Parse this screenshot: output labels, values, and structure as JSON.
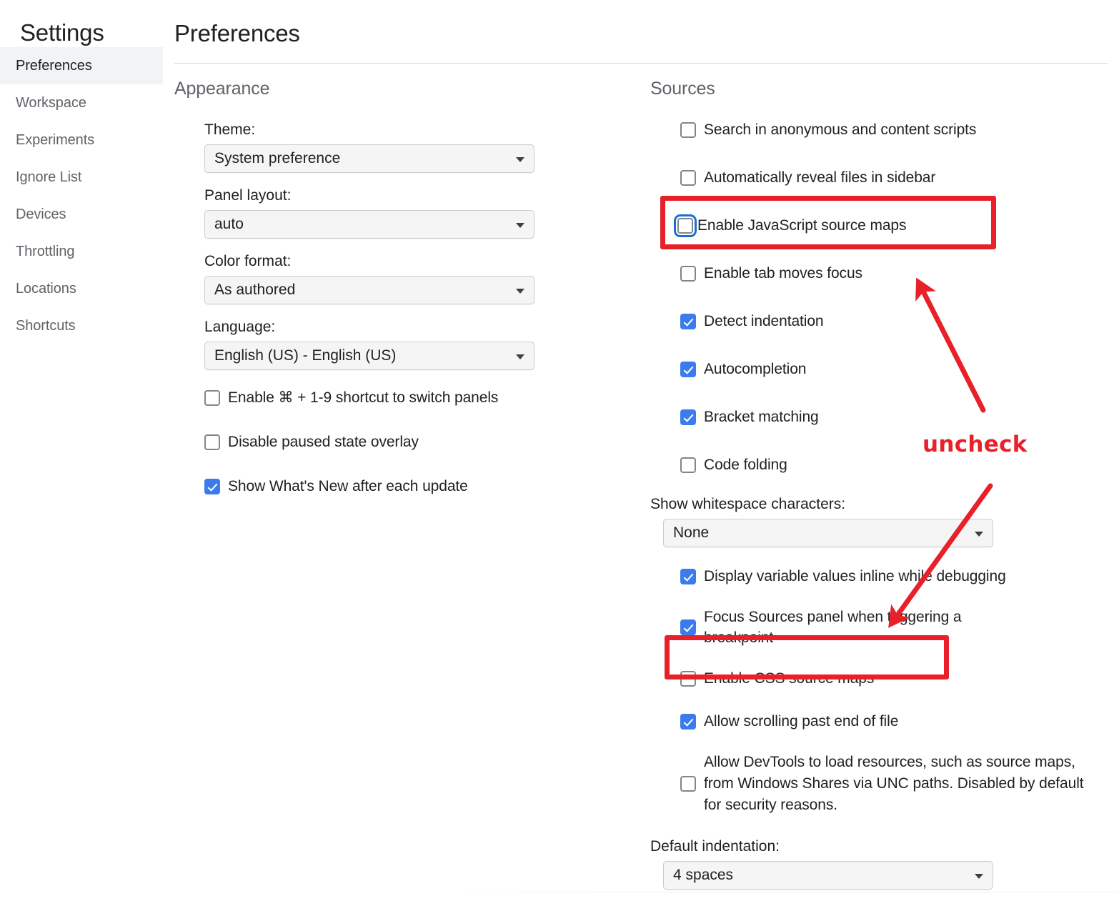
{
  "sidebar": {
    "title": "Settings",
    "items": [
      {
        "label": "Preferences",
        "selected": true
      },
      {
        "label": "Workspace",
        "selected": false
      },
      {
        "label": "Experiments",
        "selected": false
      },
      {
        "label": "Ignore List",
        "selected": false
      },
      {
        "label": "Devices",
        "selected": false
      },
      {
        "label": "Throttling",
        "selected": false
      },
      {
        "label": "Locations",
        "selected": false
      },
      {
        "label": "Shortcuts",
        "selected": false
      }
    ]
  },
  "page": {
    "title": "Preferences"
  },
  "appearance": {
    "heading": "Appearance",
    "theme": {
      "label": "Theme:",
      "value": "System preference"
    },
    "panel_layout": {
      "label": "Panel layout:",
      "value": "auto"
    },
    "color_format": {
      "label": "Color format:",
      "value": "As authored"
    },
    "language": {
      "label": "Language:",
      "value": "English (US) - English (US)"
    },
    "checkboxes": [
      {
        "label": "Enable ⌘ + 1-9 shortcut to switch panels",
        "checked": false
      },
      {
        "label": "Disable paused state overlay",
        "checked": false
      },
      {
        "label": "Show What's New after each update",
        "checked": true
      }
    ]
  },
  "sources": {
    "heading": "Sources",
    "checkboxes_top": [
      {
        "label": "Search in anonymous and content scripts",
        "checked": false
      },
      {
        "label": "Automatically reveal files in sidebar",
        "checked": false
      },
      {
        "label": "Enable JavaScript source maps",
        "checked": false,
        "focused": true,
        "annotated": true
      },
      {
        "label": "Enable tab moves focus",
        "checked": false
      },
      {
        "label": "Detect indentation",
        "checked": true
      },
      {
        "label": "Autocompletion",
        "checked": true
      },
      {
        "label": "Bracket matching",
        "checked": true
      },
      {
        "label": "Code folding",
        "checked": false
      }
    ],
    "whitespace": {
      "label": "Show whitespace characters:",
      "value": "None"
    },
    "checkboxes_mid": [
      {
        "label": "Display variable values inline while debugging",
        "checked": true
      },
      {
        "label": "Focus Sources panel when triggering a breakpoint",
        "checked": true
      },
      {
        "label": "Enable CSS source maps",
        "checked": false,
        "annotated": true
      },
      {
        "label": "Allow scrolling past end of file",
        "checked": true
      }
    ],
    "unc": {
      "label": "Allow DevTools to load resources, such as source maps, from Windows Shares via UNC paths. Disabled by default for security reasons.",
      "checked": false
    },
    "default_indentation": {
      "label": "Default indentation:",
      "value": "4 spaces"
    }
  },
  "annotations": {
    "uncheck_label": "uncheck",
    "accent_color": "#e8202a",
    "focus_color": "#1b6fd4",
    "checkbox_color": "#3b7ced"
  }
}
